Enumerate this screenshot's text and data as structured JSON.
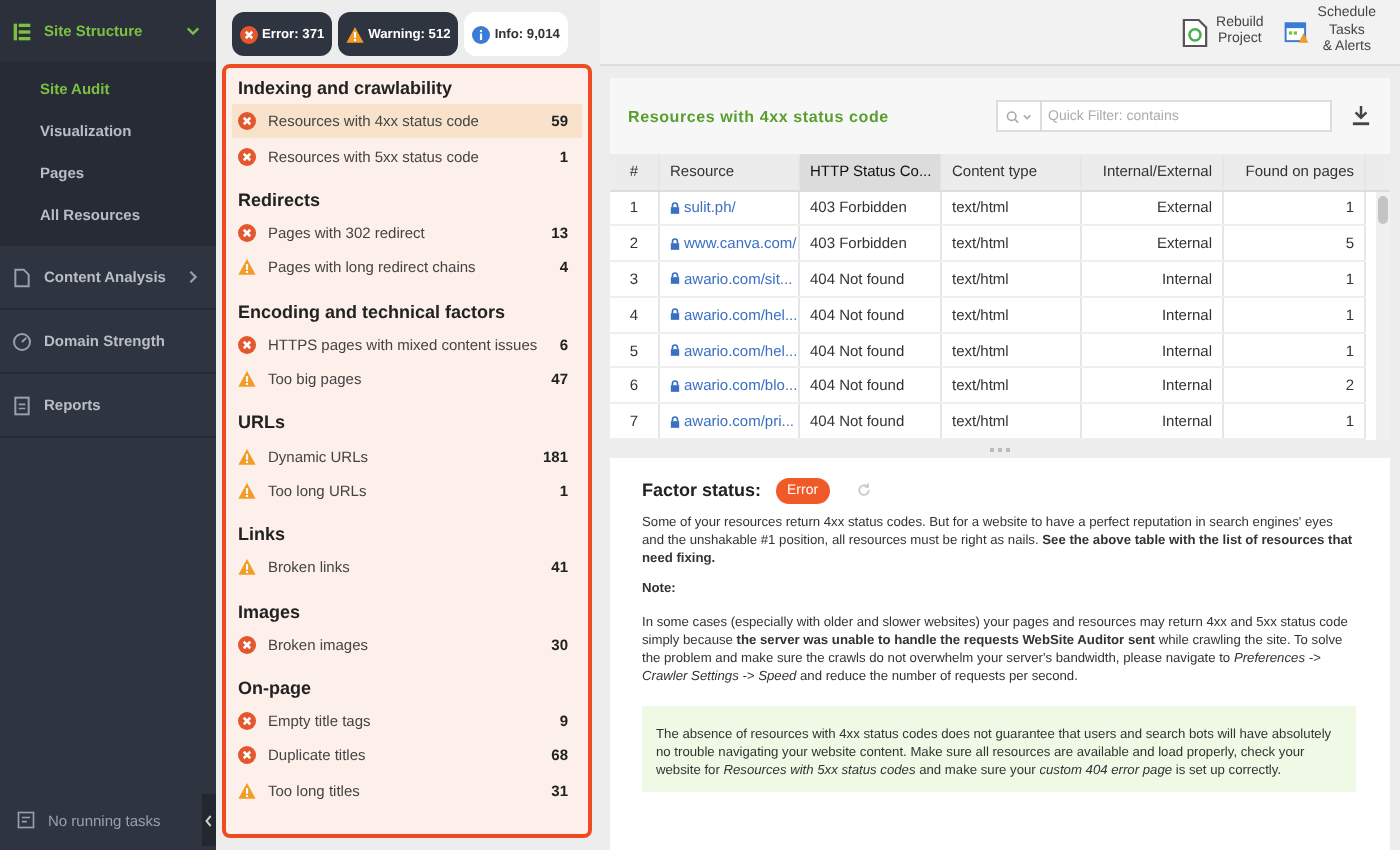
{
  "sidebar": {
    "sections": [
      {
        "label": "Site Structure",
        "expanded": true,
        "items": [
          {
            "label": "Site Audit",
            "selected": true
          },
          {
            "label": "Visualization",
            "selected": false
          },
          {
            "label": "Pages",
            "selected": false
          },
          {
            "label": "All Resources",
            "selected": false
          }
        ]
      },
      {
        "label": "Content Analysis",
        "expanded": false
      },
      {
        "label": "Domain Strength"
      },
      {
        "label": "Reports"
      }
    ],
    "footer": "No running tasks"
  },
  "badges": [
    {
      "kind": "error",
      "label": "Error: 371"
    },
    {
      "kind": "warning",
      "label": "Warning: 512"
    },
    {
      "kind": "info",
      "label": "Info: 9,014"
    }
  ],
  "factor_groups": [
    {
      "title": "Indexing and crawlability",
      "items": [
        {
          "kind": "error",
          "label": "Resources with 4xx status code",
          "count": "59",
          "selected": true
        },
        {
          "kind": "error",
          "label": "Resources with 5xx status code",
          "count": "1",
          "selected": false
        }
      ]
    },
    {
      "title": "Redirects",
      "items": [
        {
          "kind": "error",
          "label": "Pages with 302 redirect",
          "count": "13",
          "selected": false
        },
        {
          "kind": "warning",
          "label": "Pages with long redirect chains",
          "count": "4",
          "selected": false
        }
      ]
    },
    {
      "title": "Encoding and technical factors",
      "items": [
        {
          "kind": "error",
          "label": "HTTPS pages with mixed content issues",
          "count": "6",
          "selected": false
        },
        {
          "kind": "warning",
          "label": "Too big pages",
          "count": "47",
          "selected": false
        }
      ]
    },
    {
      "title": "URLs",
      "items": [
        {
          "kind": "warning",
          "label": "Dynamic URLs",
          "count": "181",
          "selected": false
        },
        {
          "kind": "warning",
          "label": "Too long URLs",
          "count": "1",
          "selected": false
        }
      ]
    },
    {
      "title": "Links",
      "items": [
        {
          "kind": "warning",
          "label": "Broken links",
          "count": "41",
          "selected": false
        }
      ]
    },
    {
      "title": "Images",
      "items": [
        {
          "kind": "error",
          "label": "Broken images",
          "count": "30",
          "selected": false
        }
      ]
    },
    {
      "title": "On-page",
      "items": [
        {
          "kind": "error",
          "label": "Empty title tags",
          "count": "9",
          "selected": false
        },
        {
          "kind": "error",
          "label": "Duplicate titles",
          "count": "68",
          "selected": false
        },
        {
          "kind": "warning",
          "label": "Too long titles",
          "count": "31",
          "selected": false
        }
      ]
    }
  ],
  "toolbar": [
    {
      "kind": "rebuild",
      "lines": [
        "Rebuild",
        "Project"
      ]
    },
    {
      "kind": "schedule",
      "lines": [
        "Schedule",
        "Tasks",
        "& Alerts"
      ]
    }
  ],
  "table": {
    "title": "Resources with 4xx status code",
    "filter": {
      "placeholder": "Quick Filter: contains"
    },
    "columns": [
      {
        "label": "#",
        "sorted": false
      },
      {
        "label": "Resource",
        "sorted": false
      },
      {
        "label": "HTTP Status Co...",
        "sorted": true
      },
      {
        "label": "Content type",
        "sorted": false
      },
      {
        "label": "Internal/External",
        "sorted": false
      },
      {
        "label": "Found on pages",
        "sorted": false
      }
    ],
    "rows": [
      [
        "1",
        "sulit.ph/",
        "403 Forbidden",
        "text/html",
        "External",
        "1"
      ],
      [
        "2",
        "www.canva.com/",
        "403 Forbidden",
        "text/html",
        "External",
        "5"
      ],
      [
        "3",
        "awario.com/sit...",
        "404 Not found",
        "text/html",
        "Internal",
        "1"
      ],
      [
        "4",
        "awario.com/hel...",
        "404 Not found",
        "text/html",
        "Internal",
        "1"
      ],
      [
        "5",
        "awario.com/hel...",
        "404 Not found",
        "text/html",
        "Internal",
        "1"
      ],
      [
        "6",
        "awario.com/blo...",
        "404 Not found",
        "text/html",
        "Internal",
        "2"
      ],
      [
        "7",
        "awario.com/pri...",
        "404 Not found",
        "text/html",
        "Internal",
        "1"
      ]
    ]
  },
  "factor_status": {
    "label": "Factor status:",
    "status": {
      "kind": "error",
      "label": "Error"
    },
    "description": "Some of your resources return 4xx status codes. But for a website to have a perfect reputation in search engines' eyes and the unshakable #1 position, all resources must be right as nails. **See the above table with the list of resources that need fixing.**",
    "note_title": "Note:",
    "note": "In some cases (especially with older and slower websites) your pages and resources may return 4xx and 5xx status code simply because **the server was unable to handle the requests WebSite Auditor sent** while crawling the site. To solve the problem and make sure the crawls do not overwhelm your server's bandwidth, please navigate to *Preferences -> Crawler Settings -> Speed* and reduce the number of requests per second.",
    "tip": "The absence of resources with 4xx status codes does not guarantee that users and search bots will have absolutely no trouble navigating your website content. Make sure all resources are available and load properly, check your website for *Resources with 5xx status codes* and make sure your *custom 404 error page* is set up correctly."
  }
}
